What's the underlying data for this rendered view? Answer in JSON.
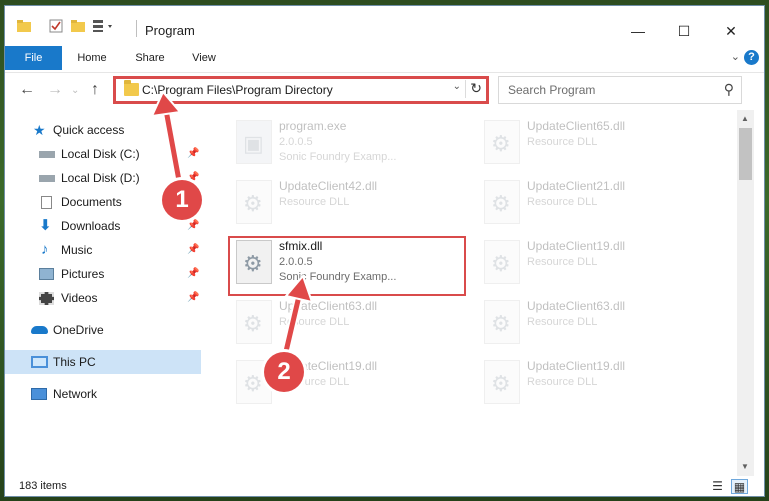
{
  "window": {
    "title": "Program",
    "controls": {
      "minimize": "—",
      "maximize": "☐",
      "close": "✕"
    }
  },
  "ribbon": {
    "tabs": [
      {
        "label": "File"
      },
      {
        "label": "Home"
      },
      {
        "label": "Share"
      },
      {
        "label": "View"
      }
    ],
    "help_label": "?"
  },
  "address_bar": {
    "path": "C:\\Program Files\\Program Directory"
  },
  "search": {
    "placeholder": "Search Program"
  },
  "navigation_pane": {
    "items": [
      {
        "label": "Quick access",
        "icon": "star-icon",
        "pinned": false
      },
      {
        "label": "Local Disk (C:)",
        "icon": "drive-icon",
        "pinned": true
      },
      {
        "label": "Local Disk (D:)",
        "icon": "drive-icon",
        "pinned": true
      },
      {
        "label": "Documents",
        "icon": "documents-icon",
        "pinned": true
      },
      {
        "label": "Downloads",
        "icon": "download-icon",
        "pinned": true
      },
      {
        "label": "Music",
        "icon": "music-icon",
        "pinned": true
      },
      {
        "label": "Pictures",
        "icon": "pictures-icon",
        "pinned": true
      },
      {
        "label": "Videos",
        "icon": "videos-icon",
        "pinned": true
      },
      {
        "label": "OneDrive",
        "icon": "onedrive-icon",
        "pinned": false
      },
      {
        "label": "This PC",
        "icon": "computer-icon",
        "pinned": false,
        "selected": true
      },
      {
        "label": "Network",
        "icon": "network-icon",
        "pinned": false
      }
    ]
  },
  "files": [
    {
      "name": "program.exe",
      "line2": "2.0.0.5",
      "line3": "Sonic Foundry Examp..."
    },
    {
      "name": "UpdateClient65.dll",
      "line2": "Resource DLL",
      "line3": ""
    },
    {
      "name": "UpdateClient42.dll",
      "line2": "Resource DLL",
      "line3": ""
    },
    {
      "name": "UpdateClient21.dll",
      "line2": "Resource DLL",
      "line3": ""
    },
    {
      "name": "sfmix.dll",
      "line2": "2.0.0.5",
      "line3": "Sonic Foundry Examp...",
      "highlighted": true
    },
    {
      "name": "UpdateClient19.dll",
      "line2": "Resource DLL",
      "line3": ""
    },
    {
      "name": "UpdateClient63.dll",
      "line2": "Resource DLL",
      "line3": ""
    },
    {
      "name": "UpdateClient63.dll",
      "line2": "Resource DLL",
      "line3": ""
    },
    {
      "name": "UpdateClient19.dll",
      "line2": "Resource DLL",
      "line3": ""
    },
    {
      "name": "UpdateClient19.dll",
      "line2": "Resource DLL",
      "line3": ""
    }
  ],
  "status_bar": {
    "item_count": "183 items"
  },
  "annotations": [
    {
      "label": "1"
    },
    {
      "label": "2"
    }
  ],
  "colors": {
    "accent": "#1979ca",
    "highlight_red": "#d94b4b",
    "selected_nav": "#cde3f7"
  }
}
